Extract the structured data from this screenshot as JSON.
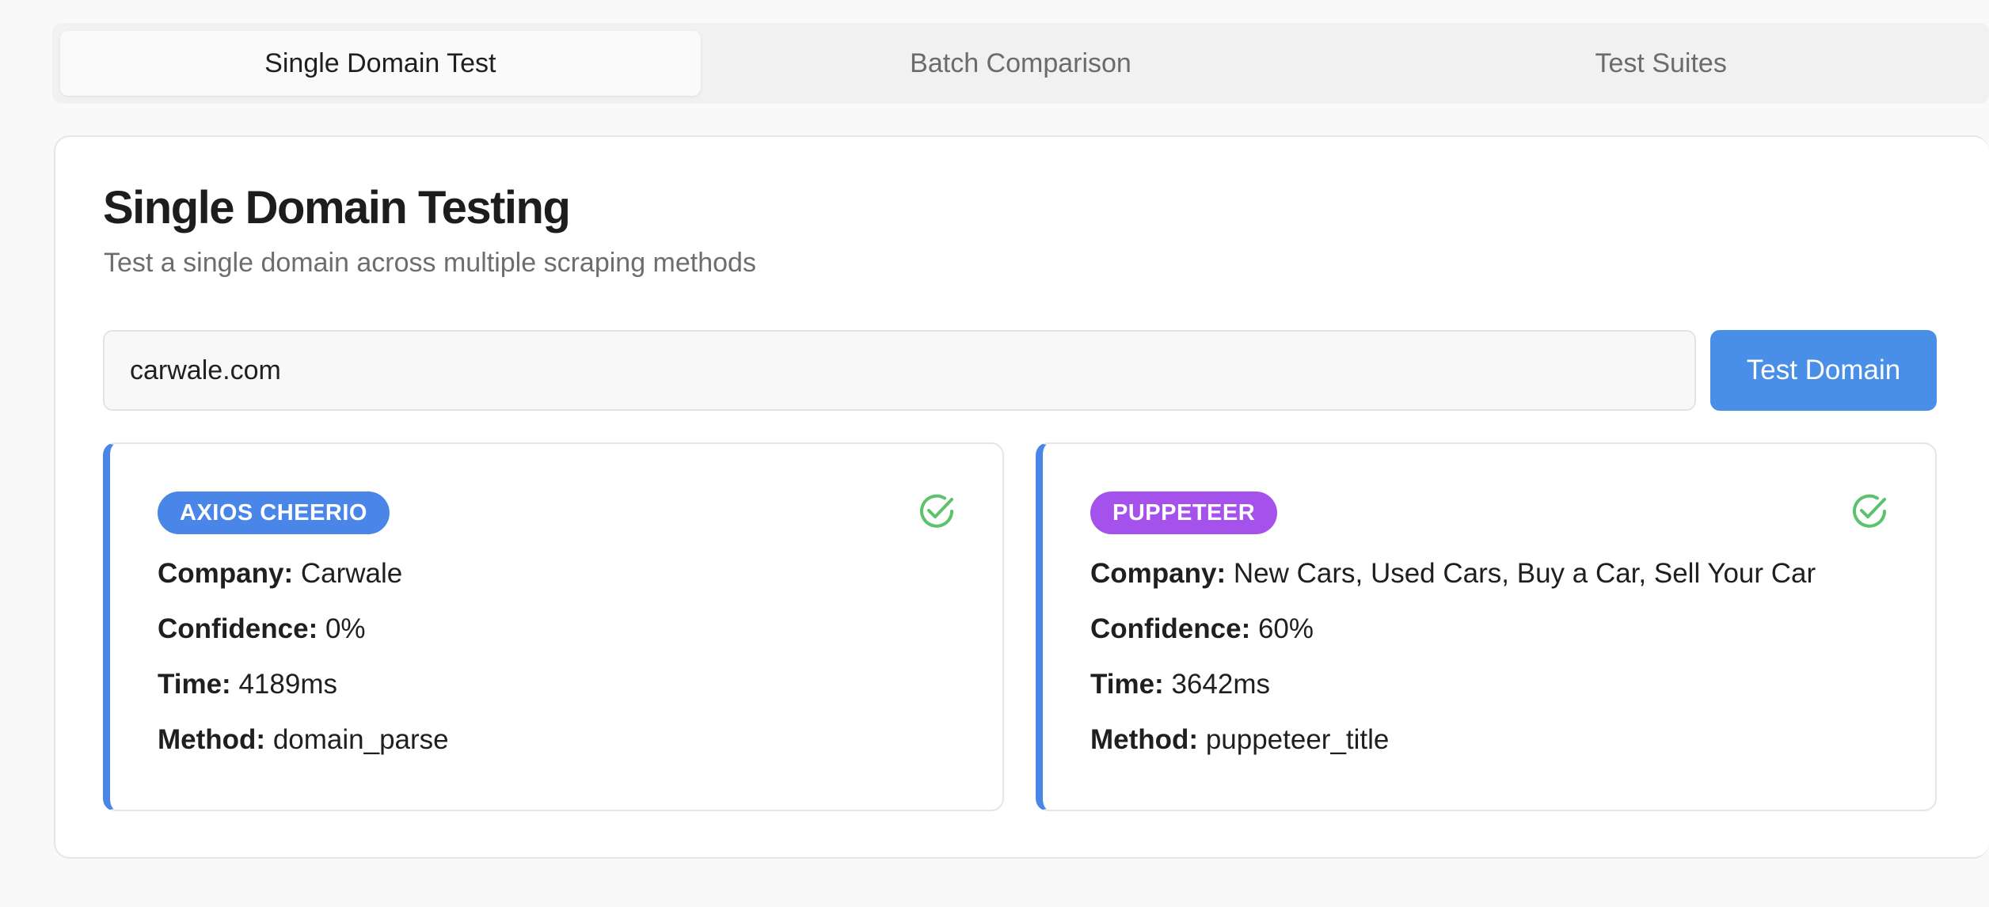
{
  "tabs": [
    {
      "label": "Single Domain Test",
      "active": true
    },
    {
      "label": "Batch Comparison",
      "active": false
    },
    {
      "label": "Test Suites",
      "active": false
    }
  ],
  "main": {
    "title": "Single Domain Testing",
    "subtitle": "Test a single domain across multiple scraping methods",
    "domain_input_value": "carwale.com",
    "test_button_label": "Test Domain"
  },
  "results": [
    {
      "method_badge": "AXIOS CHEERIO",
      "badge_color": "#4a86e8",
      "status_icon": "check-circle-icon",
      "company_label": "Company:",
      "company": "Carwale",
      "confidence_label": "Confidence:",
      "confidence": "0%",
      "time_label": "Time:",
      "time": "4189ms",
      "method_label": "Method:",
      "method": "domain_parse"
    },
    {
      "method_badge": "PUPPETEER",
      "badge_color": "#a452eb",
      "status_icon": "check-circle-icon",
      "company_label": "Company:",
      "company": "New Cars, Used Cars, Buy a Car, Sell Your Car",
      "confidence_label": "Confidence:",
      "confidence": "60%",
      "time_label": "Time:",
      "time": "3642ms",
      "method_label": "Method:",
      "method": "puppeteer_title"
    }
  ],
  "colors": {
    "accent": "#4a8fe7",
    "success": "#5cc26b"
  }
}
